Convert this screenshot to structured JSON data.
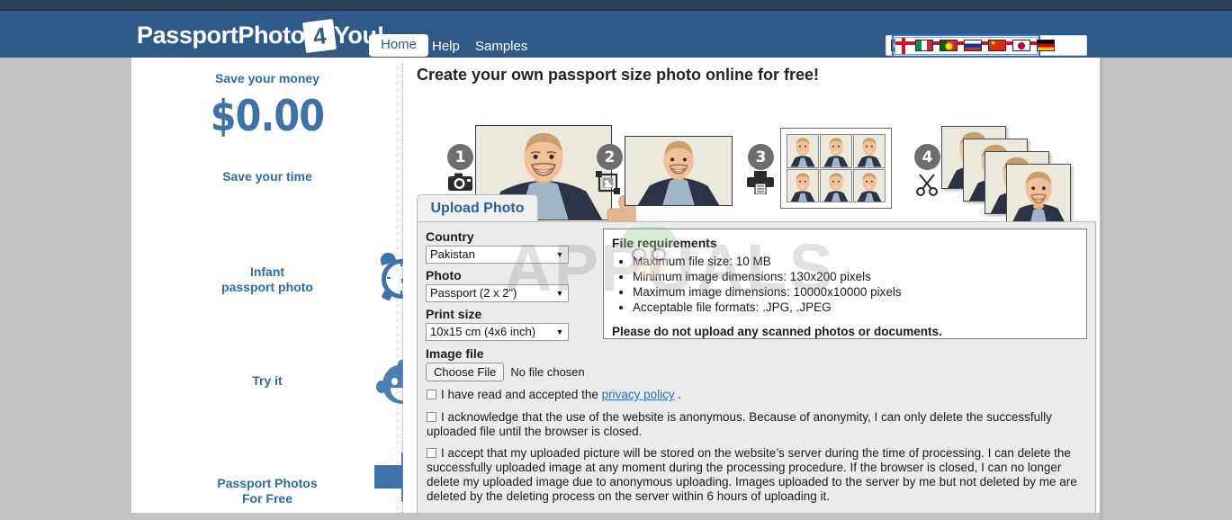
{
  "header": {
    "logo_pre": "PassportPhoto",
    "logo_four": "4",
    "logo_post": "You!",
    "nav": {
      "home": "Home",
      "help": "Help",
      "samples": "Samples"
    },
    "flags": [
      {
        "name": "hungary",
        "selected": false
      },
      {
        "name": "united-kingdom",
        "selected": true
      },
      {
        "name": "italy",
        "selected": false
      },
      {
        "name": "portugal",
        "selected": false
      },
      {
        "name": "russia",
        "selected": false
      },
      {
        "name": "china",
        "selected": false
      },
      {
        "name": "japan",
        "selected": false
      },
      {
        "name": "germany",
        "selected": false
      }
    ],
    "colors": {
      "band": "#2f5a88",
      "topstrip": "#2b4256"
    }
  },
  "sidebar": {
    "save_money_title": "Save your money",
    "price": "$0.00",
    "save_time_title": "Save your time",
    "infant_title_line1": "Infant",
    "infant_title_line2": "passport photo",
    "try_it_title": "Try it",
    "bottom_line1": "Passport Photos",
    "bottom_line2": "For Free",
    "accent_color": "#3f72aa",
    "check_color": "#22a431"
  },
  "main": {
    "title": "Create your own passport size photo online for free!",
    "steps": [
      {
        "number": "1",
        "icon": "camera-icon"
      },
      {
        "number": "2",
        "icon": "crop-icon"
      },
      {
        "number": "3",
        "icon": "printer-icon"
      },
      {
        "number": "4",
        "icon": "scissors-icon"
      }
    ],
    "tab_label": "Upload Photo",
    "form": {
      "country_label": "Country",
      "country_value": "Pakistan",
      "photo_label": "Photo",
      "photo_value": "Passport (2 x 2\")",
      "print_label": "Print size",
      "print_value": "10x15 cm (4x6 inch)",
      "image_label": "Image file",
      "choose_file_button": "Choose File",
      "no_file_text": "No file chosen"
    },
    "requirements": {
      "title": "File requirements",
      "items": [
        "Maximum file size: 10 MB",
        "Minimum image dimensions: 130x200 pixels",
        "Maximum image dimensions: 10000x10000 pixels",
        "Acceptable file formats: .JPG, .JPEG"
      ],
      "note": "Please do not upload any scanned photos or documents."
    },
    "consents": [
      {
        "pre": "I have read and accepted the ",
        "link": "privacy policy",
        "post": " ."
      },
      {
        "text": "I acknowledge that the use of the website is anonymous. Because of anonymity, I can only delete the successfully uploaded file until the browser is closed."
      },
      {
        "text": "I accept that my uploaded picture will be stored on the website’s server during the time of processing. I can delete the successfully uploaded image at any moment during the processing procedure. If the browser is closed, I can no longer delete my uploaded image due to anonymous uploading. Images uploaded to the server by me but not deleted by me are deleted by the deleting process on the server within 6 hours of uploading it."
      }
    ]
  },
  "watermark": {
    "text": "APPUALS"
  }
}
